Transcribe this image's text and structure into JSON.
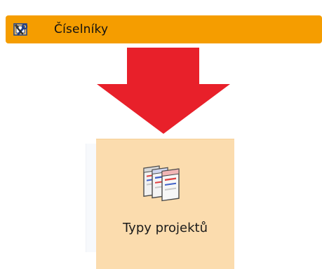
{
  "menu": {
    "label": "Číselníky",
    "icon": "tools-icon",
    "color": "#f59d00"
  },
  "arrow": {
    "color": "#e8202a",
    "direction": "down"
  },
  "ribbon": {
    "button_label": "Typy projektů",
    "button_icon": "project-types-icon",
    "highlight_color": "#fbdcae"
  }
}
